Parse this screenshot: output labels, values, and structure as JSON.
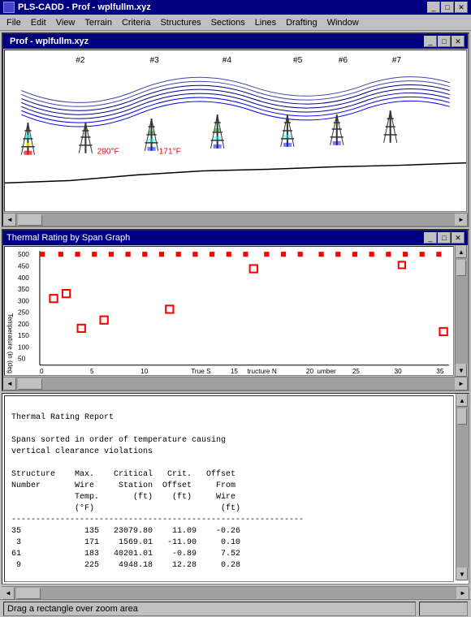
{
  "app": {
    "title": "PLS-CADD - Prof - wplfullm.xyz",
    "icon": "app-icon"
  },
  "menubar": {
    "items": [
      "File",
      "Edit",
      "View",
      "Terrain",
      "Criteria",
      "Structures",
      "Sections",
      "Lines",
      "Drafting",
      "Window"
    ]
  },
  "prof_window": {
    "title": "Prof - wplfullm.xyz"
  },
  "profile": {
    "structure_labels": [
      "#2",
      "#3",
      "#4",
      "#5",
      "#6",
      "#7"
    ],
    "temp_labels": [
      "290°F",
      "171°F"
    ]
  },
  "thermal_window": {
    "title": "Thermal Rating by Span Graph"
  },
  "graph": {
    "y_label": "Temperature (in (deg",
    "y_axis": [
      "500",
      "450",
      "400",
      "350",
      "300",
      "250",
      "200",
      "150",
      "100",
      "50"
    ],
    "x_axis": [
      "0",
      "5",
      "10",
      "True S15ucture N20umber",
      "25",
      "30",
      "35"
    ],
    "x_label": "True Structure Number"
  },
  "report": {
    "title": "Thermal Rating Report",
    "subtitle": "Spans sorted in order of temperature causing\nvertical clearance violations",
    "headers": {
      "col1": "Structure",
      "col2": "Max.",
      "col3": "Critical",
      "col4": "Crit.",
      "col5": "Offset",
      "col1b": "Number",
      "col2b": "Wire",
      "col3b": "Station",
      "col4b": "Offset",
      "col5b": "From",
      "col2c": "Temp.",
      "col3c": "(ft)",
      "col4c": "(ft)",
      "col5c": "Wire",
      "col2d": "(°F)",
      "col5d": "(ft)"
    },
    "separator": "------------------------------------------------------------",
    "rows": [
      {
        "structure": "35",
        "max_temp": "135",
        "station": "23079.80",
        "crit_offset": "11.09",
        "offset_from": "-0.26"
      },
      {
        "structure": "3",
        "max_temp": "171",
        "station": "1569.01",
        "crit_offset": "-11.90",
        "offset_from": "0.10"
      },
      {
        "structure": "61",
        "max_temp": "183",
        "station": "40201.01",
        "crit_offset": "-0.89",
        "offset_from": "7.52"
      },
      {
        "structure": "9",
        "max_temp": "225",
        "station": "4948.18",
        "crit_offset": "12.28",
        "offset_from": "0.28"
      }
    ]
  },
  "statusbar": {
    "text": "Drag a rectangle over zoom area"
  },
  "colors": {
    "titlebar": "#000080",
    "bg": "#c0c0c0",
    "white": "#ffffff",
    "red": "#ff0000",
    "blue": "#0000cc",
    "dark_red": "#cc0000"
  }
}
